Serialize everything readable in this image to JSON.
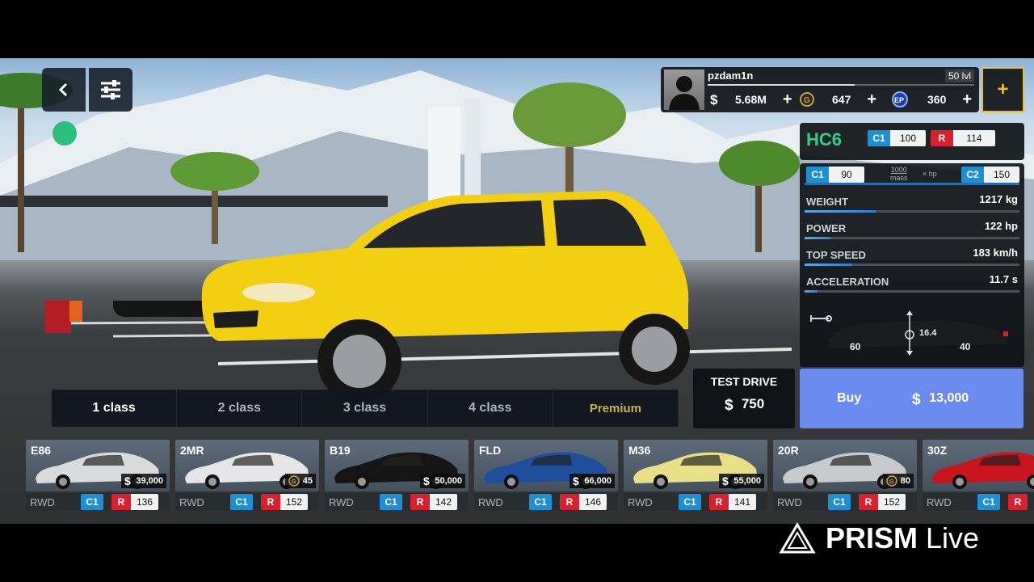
{
  "nav": {
    "back_icon": "chevron-left-icon",
    "filter_icon": "sliders-icon"
  },
  "profile": {
    "name": "pzdam1n",
    "level": "50 lvl",
    "xp_fraction": 0.55,
    "cash": "5.68M",
    "gold": "647",
    "ep": "360",
    "add_label": "+"
  },
  "car": {
    "model": "HC6",
    "class_label": "C1",
    "class_value": "100",
    "rating_label": "R",
    "rating_value": "114",
    "range_min_label": "C1",
    "range_min": "90",
    "range_max_label": "C2",
    "range_max": "150",
    "ratio_top": "1000",
    "ratio_bottom": "mass",
    "ratio_unit": "hp",
    "stats": [
      {
        "label": "WEIGHT",
        "value": "1217 kg",
        "fraction": 0.33
      },
      {
        "label": "POWER",
        "value": "122 hp",
        "fraction": 0.12
      },
      {
        "label": "TOP SPEED",
        "value": "183 km/h",
        "fraction": 0.22
      },
      {
        "label": "ACCELERATION",
        "value": "11.7 s",
        "fraction": 0.06
      }
    ],
    "front_dist": "60",
    "height": "16.4",
    "rear_dist": "40"
  },
  "actions": {
    "test_drive_label": "TEST DRIVE",
    "test_drive_price": "750",
    "buy_label": "Buy",
    "buy_price": "13,000"
  },
  "tabs": [
    "1 class",
    "2 class",
    "3 class",
    "4 class",
    "Premium"
  ],
  "car_list": [
    {
      "name": "E86",
      "price": "39,000",
      "currency": "cash",
      "drive": "RWD",
      "class": "C1",
      "rating": "136",
      "color": "#d9dadc"
    },
    {
      "name": "2MR",
      "price": "45",
      "currency": "gold",
      "drive": "RWD",
      "class": "C1",
      "rating": "152",
      "color": "#e6e6e8"
    },
    {
      "name": "B19",
      "price": "50,000",
      "currency": "cash",
      "drive": "RWD",
      "class": "C1",
      "rating": "142",
      "color": "#151515"
    },
    {
      "name": "FLD",
      "price": "66,000",
      "currency": "cash",
      "drive": "RWD",
      "class": "C1",
      "rating": "146",
      "color": "#1f4f9c"
    },
    {
      "name": "M36",
      "price": "55,000",
      "currency": "cash",
      "drive": "RWD",
      "class": "C1",
      "rating": "141",
      "color": "#e8df86"
    },
    {
      "name": "20R",
      "price": "80",
      "currency": "gold",
      "drive": "RWD",
      "class": "C1",
      "rating": "152",
      "color": "#c7c9cc"
    },
    {
      "name": "30Z",
      "price": "",
      "currency": "cash",
      "drive": "RWD",
      "class": "C1",
      "rating": "",
      "color": "#c8141c"
    }
  ],
  "watermark": {
    "brand": "PRISM",
    "suffix": "Live"
  },
  "colors": {
    "accent_green": "#28d48b",
    "class_blue": "#1f8fd4",
    "rating_red": "#d8202f",
    "buy_blue": "#6a8bf0",
    "gold": "#e8c224"
  }
}
